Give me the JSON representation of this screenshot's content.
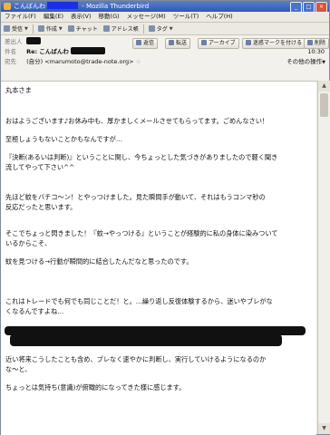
{
  "window": {
    "title_prefix": "こんばんわ",
    "title_suffix": "- Mozilla Thunderbird",
    "min": "_",
    "max": "□",
    "close": "×"
  },
  "menu": [
    "ファイル(F)",
    "編集(E)",
    "表示(V)",
    "移動(G)",
    "メッセージ(M)",
    "ツール(T)",
    "ヘルプ(H)"
  ],
  "toolbar": {
    "receive": "受信",
    "compose": "作成",
    "chat": "チャット",
    "address": "アドレス帳",
    "tag": "タグ"
  },
  "actions": {
    "reply": "返信",
    "forward": "転送",
    "archive": "アーカイブ",
    "junk": "迷惑マークを付ける",
    "delete": "削除"
  },
  "header": {
    "from_label": "差出人",
    "subject_label": "件名",
    "subject": "Re: こんばんわ",
    "to_label": "宛先",
    "to_value": "(自分) <marumoto@trade-note.org>",
    "time": "10:30",
    "other_actions": "その他の操作"
  },
  "body": {
    "line1": "丸本さま",
    "line2": "おはようございます♪お休み中も、厚かましくメールさせてもらってます。ごめんなさい！",
    "line3": "至極しょうもないことかもなんですが…",
    "line4": "『決断(あるいは判断)』ということに関し、今ちょっとした気づきがありましたので軽く聞き",
    "line5": "流してやって下さい^^",
    "line6": "先ほど蚊をバチコ〜ン！とやっつけました。見た瞬間手が動いて、それはもうコンマ秒の",
    "line7": "反応だったと思います。",
    "line8": "そこでちょっと閃きました！『蚊→やっつける』ということが経験的に私の身体に染みついて",
    "line9": "いるからこそ、",
    "line10": "蚊を見つける→行動が瞬間的に結合したんだなと思ったのです。",
    "line11": "これはトレードでも何でも同じことだ！と。…繰り返し反復体験するから、迷いやブレがな",
    "line12": "くなるんですよね…",
    "line13": "近い将来こうしたことも含め、ブレなく速やかに判断し、実行していけるようになるのか",
    "line14": "な〜と、",
    "line15": "ちょっとは気持ち(意識)が俯瞰的になってきた様に感じます。"
  }
}
